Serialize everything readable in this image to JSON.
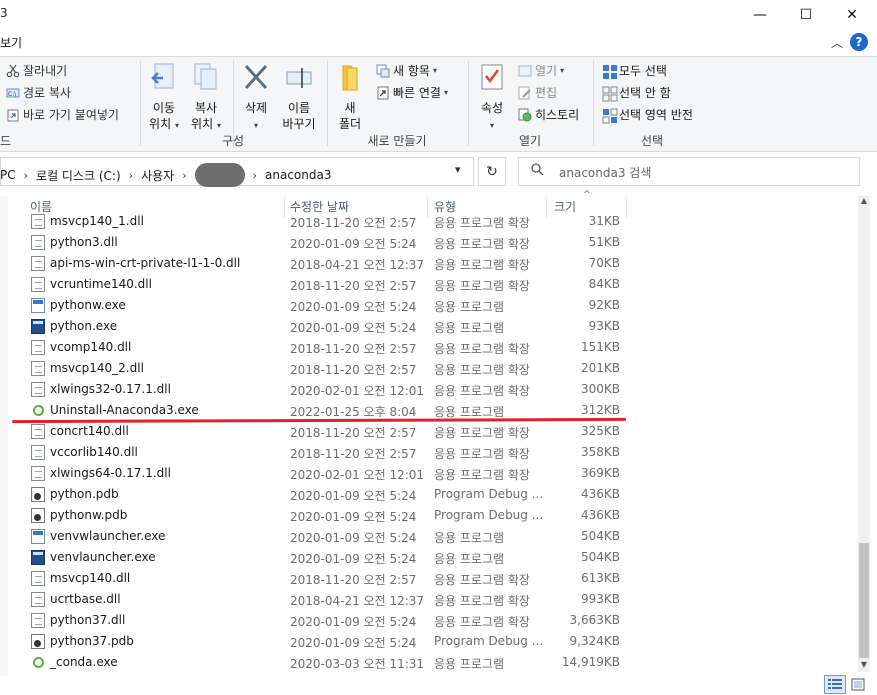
{
  "window": {
    "title": "3",
    "minimize": "—",
    "maximize": "☐",
    "close": "✕"
  },
  "menu": {
    "view": "보기",
    "help": "?",
    "collapse": "︿"
  },
  "ribbon": {
    "organize": {
      "partial": "드",
      "cut": "잘라내기",
      "copy_path": "경로 복사",
      "paste_shortcut": "바로 가기 붙여넣기",
      "move_to": [
        "이동",
        "위치"
      ],
      "copy_to": [
        "복사",
        "위치"
      ],
      "delete": "삭제",
      "rename": [
        "이름",
        "바꾸기"
      ],
      "label": "구성"
    },
    "new": {
      "new_folder": [
        "새",
        "폴더"
      ],
      "new_item": "새 항목",
      "easy_access": "빠른 연결",
      "label": "새로 만들기"
    },
    "open": {
      "properties": "속성",
      "open": "열기",
      "edit": "편집",
      "history": "히스토리",
      "label": "열기"
    },
    "select": {
      "select_all": "모두 선택",
      "select_none": "선택 안 함",
      "invert": "선택 영역 반전",
      "label": "선택"
    }
  },
  "address": {
    "crumbs": [
      "PC",
      "로컬 디스크 (C:)",
      "사용자",
      "anaconda3"
    ],
    "search_placeholder": "anaconda3 검색"
  },
  "columns": {
    "name": "이름",
    "date": "수정한 날짜",
    "type": "유형",
    "size": "크기"
  },
  "files": [
    {
      "name": "msvcp140_1.dll",
      "date": "2018-11-20 오전 2:57",
      "type": "응용 프로그램 확장",
      "size": "31KB",
      "icon": "doc"
    },
    {
      "name": "python3.dll",
      "date": "2020-01-09 오전 5:24",
      "type": "응용 프로그램 확장",
      "size": "51KB",
      "icon": "doc"
    },
    {
      "name": "api-ms-win-crt-private-l1-1-0.dll",
      "date": "2018-04-21 오전 12:37",
      "type": "응용 프로그램 확장",
      "size": "70KB",
      "icon": "doc"
    },
    {
      "name": "vcruntime140.dll",
      "date": "2018-11-20 오전 2:57",
      "type": "응용 프로그램 확장",
      "size": "84KB",
      "icon": "doc"
    },
    {
      "name": "pythonw.exe",
      "date": "2020-01-09 오전 5:24",
      "type": "응용 프로그램",
      "size": "92KB",
      "icon": "pyw"
    },
    {
      "name": "python.exe",
      "date": "2020-01-09 오전 5:24",
      "type": "응용 프로그램",
      "size": "93KB",
      "icon": "exe"
    },
    {
      "name": "vcomp140.dll",
      "date": "2018-11-20 오전 2:57",
      "type": "응용 프로그램 확장",
      "size": "151KB",
      "icon": "doc"
    },
    {
      "name": "msvcp140_2.dll",
      "date": "2018-11-20 오전 2:57",
      "type": "응용 프로그램 확장",
      "size": "201KB",
      "icon": "doc"
    },
    {
      "name": "xlwings32-0.17.1.dll",
      "date": "2020-02-01 오전 12:01",
      "type": "응용 프로그램 확장",
      "size": "300KB",
      "icon": "doc"
    },
    {
      "name": "Uninstall-Anaconda3.exe",
      "date": "2022-01-25 오후 8:04",
      "type": "응용 프로그램",
      "size": "312KB",
      "icon": "ring"
    },
    {
      "name": "concrt140.dll",
      "date": "2018-11-20 오전 2:57",
      "type": "응용 프로그램 확장",
      "size": "325KB",
      "icon": "doc"
    },
    {
      "name": "vccorlib140.dll",
      "date": "2018-11-20 오전 2:57",
      "type": "응용 프로그램 확장",
      "size": "358KB",
      "icon": "doc"
    },
    {
      "name": "xlwings64-0.17.1.dll",
      "date": "2020-02-01 오전 12:01",
      "type": "응용 프로그램 확장",
      "size": "369KB",
      "icon": "doc"
    },
    {
      "name": "python.pdb",
      "date": "2020-01-09 오전 5:24",
      "type": "Program Debug ...",
      "size": "436KB",
      "icon": "pdb"
    },
    {
      "name": "pythonw.pdb",
      "date": "2020-01-09 오전 5:24",
      "type": "Program Debug ...",
      "size": "436KB",
      "icon": "pdb"
    },
    {
      "name": "venvwlauncher.exe",
      "date": "2020-01-09 오전 5:24",
      "type": "응용 프로그램",
      "size": "504KB",
      "icon": "pyw"
    },
    {
      "name": "venvlauncher.exe",
      "date": "2020-01-09 오전 5:24",
      "type": "응용 프로그램",
      "size": "504KB",
      "icon": "exe"
    },
    {
      "name": "msvcp140.dll",
      "date": "2018-11-20 오전 2:57",
      "type": "응용 프로그램 확장",
      "size": "613KB",
      "icon": "doc"
    },
    {
      "name": "ucrtbase.dll",
      "date": "2018-04-21 오전 12:37",
      "type": "응용 프로그램 확장",
      "size": "993KB",
      "icon": "doc"
    },
    {
      "name": "python37.dll",
      "date": "2020-01-09 오전 5:24",
      "type": "응용 프로그램 확장",
      "size": "3,663KB",
      "icon": "doc"
    },
    {
      "name": "python37.pdb",
      "date": "2020-01-09 오전 5:24",
      "type": "Program Debug ...",
      "size": "9,324KB",
      "icon": "pdb"
    },
    {
      "name": "_conda.exe",
      "date": "2020-03-03 오전 11:31",
      "type": "응용 프로그램",
      "size": "14,919KB",
      "icon": "ring"
    }
  ]
}
